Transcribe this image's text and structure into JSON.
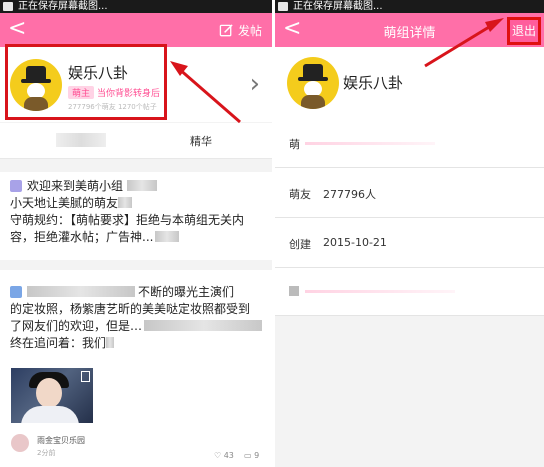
{
  "status_bar": {
    "text": "正在保存屏幕截图..."
  },
  "left": {
    "top_bar": {
      "back_glyph": "<",
      "post_label": "发帖"
    },
    "group": {
      "name": "娱乐八卦",
      "badge": "萌主",
      "motto": "当你背影转身后",
      "stats": "277796个萌友  1270个帖子"
    },
    "tabs": {
      "right_label": "精华"
    },
    "posts": [
      {
        "lines": [
          "欢迎来到美萌小组",
          "小天地让美腻的萌友",
          "守萌规约：【萌帖要求】拒绝与本萌组无关内",
          "容，拒绝灌水帖；广告神..."
        ]
      },
      {
        "lines": [
          "不断的曝光主演们",
          "的定妆照，杨紫唐艺昕的美美哒定妆照都受到",
          "了网友们的欢迎，但是…",
          "终在追问着：我们"
        ],
        "author": "雨金宝贝乐园",
        "time": "2分前",
        "likes": "43",
        "comments": "9"
      }
    ]
  },
  "right": {
    "top_bar": {
      "back_glyph": "<",
      "title": "萌组详情",
      "exit_label": "退出"
    },
    "group": {
      "name": "娱乐八卦"
    },
    "info": [
      {
        "key": "萌",
        "value": ""
      },
      {
        "key": "萌友",
        "value": "277796人"
      },
      {
        "key": "创建",
        "value": "2015-10-21"
      }
    ]
  },
  "colors": {
    "accent_pink": "#ff6fa8",
    "highlight_red": "#d8141b"
  },
  "icons": [
    "back-arrow-icon",
    "edit-post-icon",
    "chevron-right-icon",
    "like-icon",
    "comment-icon",
    "red-pointer-arrow"
  ]
}
